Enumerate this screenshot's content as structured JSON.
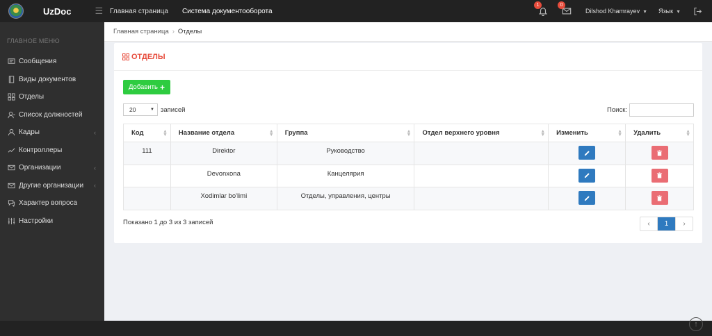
{
  "app": {
    "name": "UzDoc"
  },
  "topnav": {
    "home": "Главная страница",
    "docsystem": "Система документооборота"
  },
  "header": {
    "notifications_count": "1",
    "messages_count": "0",
    "user_name": "Dilshod Khamrayev",
    "language_label": "Язык"
  },
  "sidebar": {
    "title": "ГЛАВНОЕ МЕНЮ",
    "items": [
      {
        "label": "Сообщения",
        "icon": "message-icon",
        "has_arrow": false
      },
      {
        "label": "Виды документов",
        "icon": "document-icon",
        "has_arrow": false
      },
      {
        "label": "Отделы",
        "icon": "grid-icon",
        "has_arrow": false
      },
      {
        "label": "Список должностей",
        "icon": "user-list-icon",
        "has_arrow": false
      },
      {
        "label": "Кадры",
        "icon": "user-icon",
        "has_arrow": true
      },
      {
        "label": "Контроллеры",
        "icon": "chart-line-icon",
        "has_arrow": false
      },
      {
        "label": "Организации",
        "icon": "envelope-icon",
        "has_arrow": true
      },
      {
        "label": "Другие организации",
        "icon": "envelope-icon",
        "has_arrow": true
      },
      {
        "label": "Характер вопроса",
        "icon": "chat-icon",
        "has_arrow": false
      },
      {
        "label": "Настройки",
        "icon": "sliders-icon",
        "has_arrow": false
      }
    ]
  },
  "breadcrumb": {
    "home": "Главная страница",
    "current": "Отделы"
  },
  "panel": {
    "title": "ОТДЕЛЫ",
    "add_label": "Добавить",
    "length_value": "20",
    "length_suffix": "записей",
    "search_label": "Поиск:",
    "search_value": ""
  },
  "table": {
    "columns": [
      "Код",
      "Название отдела",
      "Группа",
      "Отдел верхнего уровня",
      "Изменить",
      "Удалить"
    ],
    "rows": [
      {
        "code": "111",
        "name": "Direktor",
        "group": "Руководство",
        "parent": ""
      },
      {
        "code": "",
        "name": "Devonxona",
        "group": "Канцелярия",
        "parent": ""
      },
      {
        "code": "",
        "name": "Xodimlar bo'limi",
        "group": "Отделы, управления, центры",
        "parent": ""
      }
    ]
  },
  "footer": {
    "info": "Показано 1 до 3 из 3 записей",
    "prev": "‹",
    "page": "1",
    "next": "›"
  },
  "colors": {
    "accent_red": "#e74c3c",
    "add_green": "#2ecc40",
    "edit_blue": "#2f7abf",
    "delete_pink": "#ea6d74"
  }
}
